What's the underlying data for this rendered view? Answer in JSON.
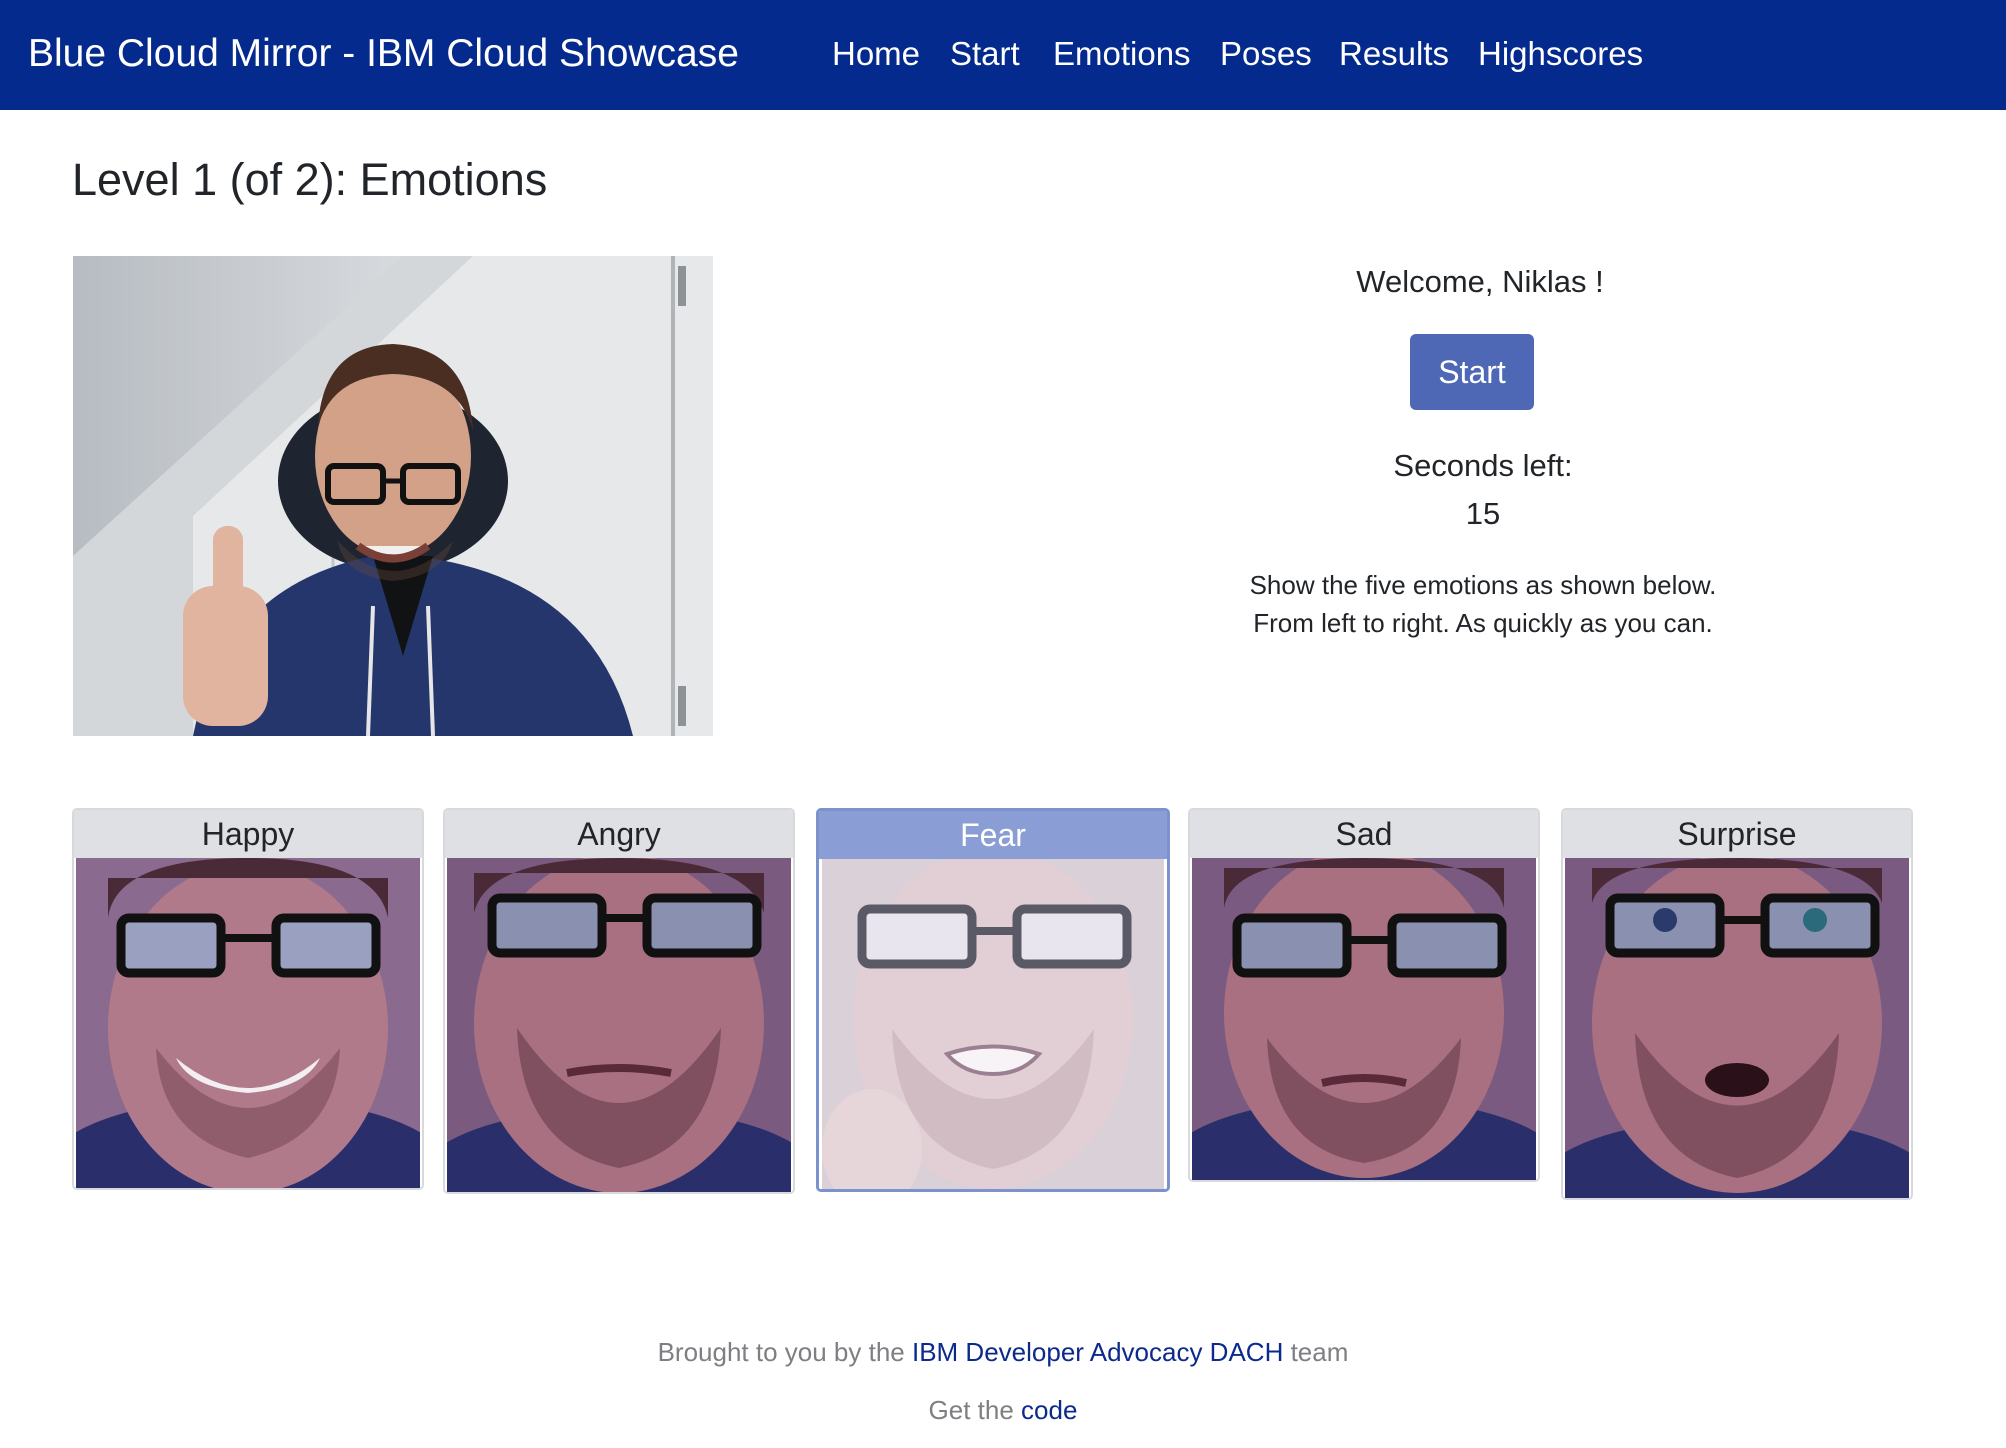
{
  "navbar": {
    "brand": "Blue Cloud Mirror - IBM Cloud Showcase",
    "items": [
      "Home",
      "Start",
      "Emotions",
      "Poses",
      "Results",
      "Highscores"
    ]
  },
  "page_title": "Level 1 (of 2): Emotions",
  "panel": {
    "welcome": "Welcome, Niklas !",
    "start_label": "Start",
    "seconds_label": "Seconds left:",
    "seconds_value": "15",
    "instructions_line1": "Show the five emotions as shown below.",
    "instructions_line2": "From left to right. As quickly as you can."
  },
  "emotions": [
    {
      "label": "Happy"
    },
    {
      "label": "Angry"
    },
    {
      "label": "Fear"
    },
    {
      "label": "Sad"
    },
    {
      "label": "Surprise"
    }
  ],
  "footer": {
    "line1_prefix": "Brought to you by the ",
    "line1_link": "IBM Developer Advocacy DACH",
    "line1_suffix": " team",
    "line2_prefix": "Get the ",
    "line2_link": "code"
  },
  "colors": {
    "navbar": "#052a8e",
    "button": "#4f68b6",
    "active_header": "#8a9dd4",
    "link": "#0b2a8c"
  }
}
